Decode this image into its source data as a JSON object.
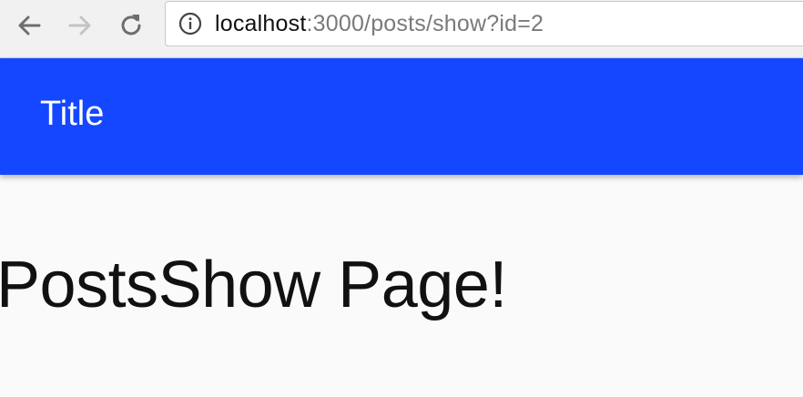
{
  "browser": {
    "url_host": "localhost",
    "url_path": ":3000/posts/show?id=2",
    "icons": {
      "back": "arrow-left",
      "forward": "arrow-right",
      "reload": "reload",
      "site_info": "info-circle"
    }
  },
  "app_bar": {
    "title": "Title",
    "color": "#1447ff"
  },
  "main": {
    "heading": "PostsShow Page!"
  }
}
